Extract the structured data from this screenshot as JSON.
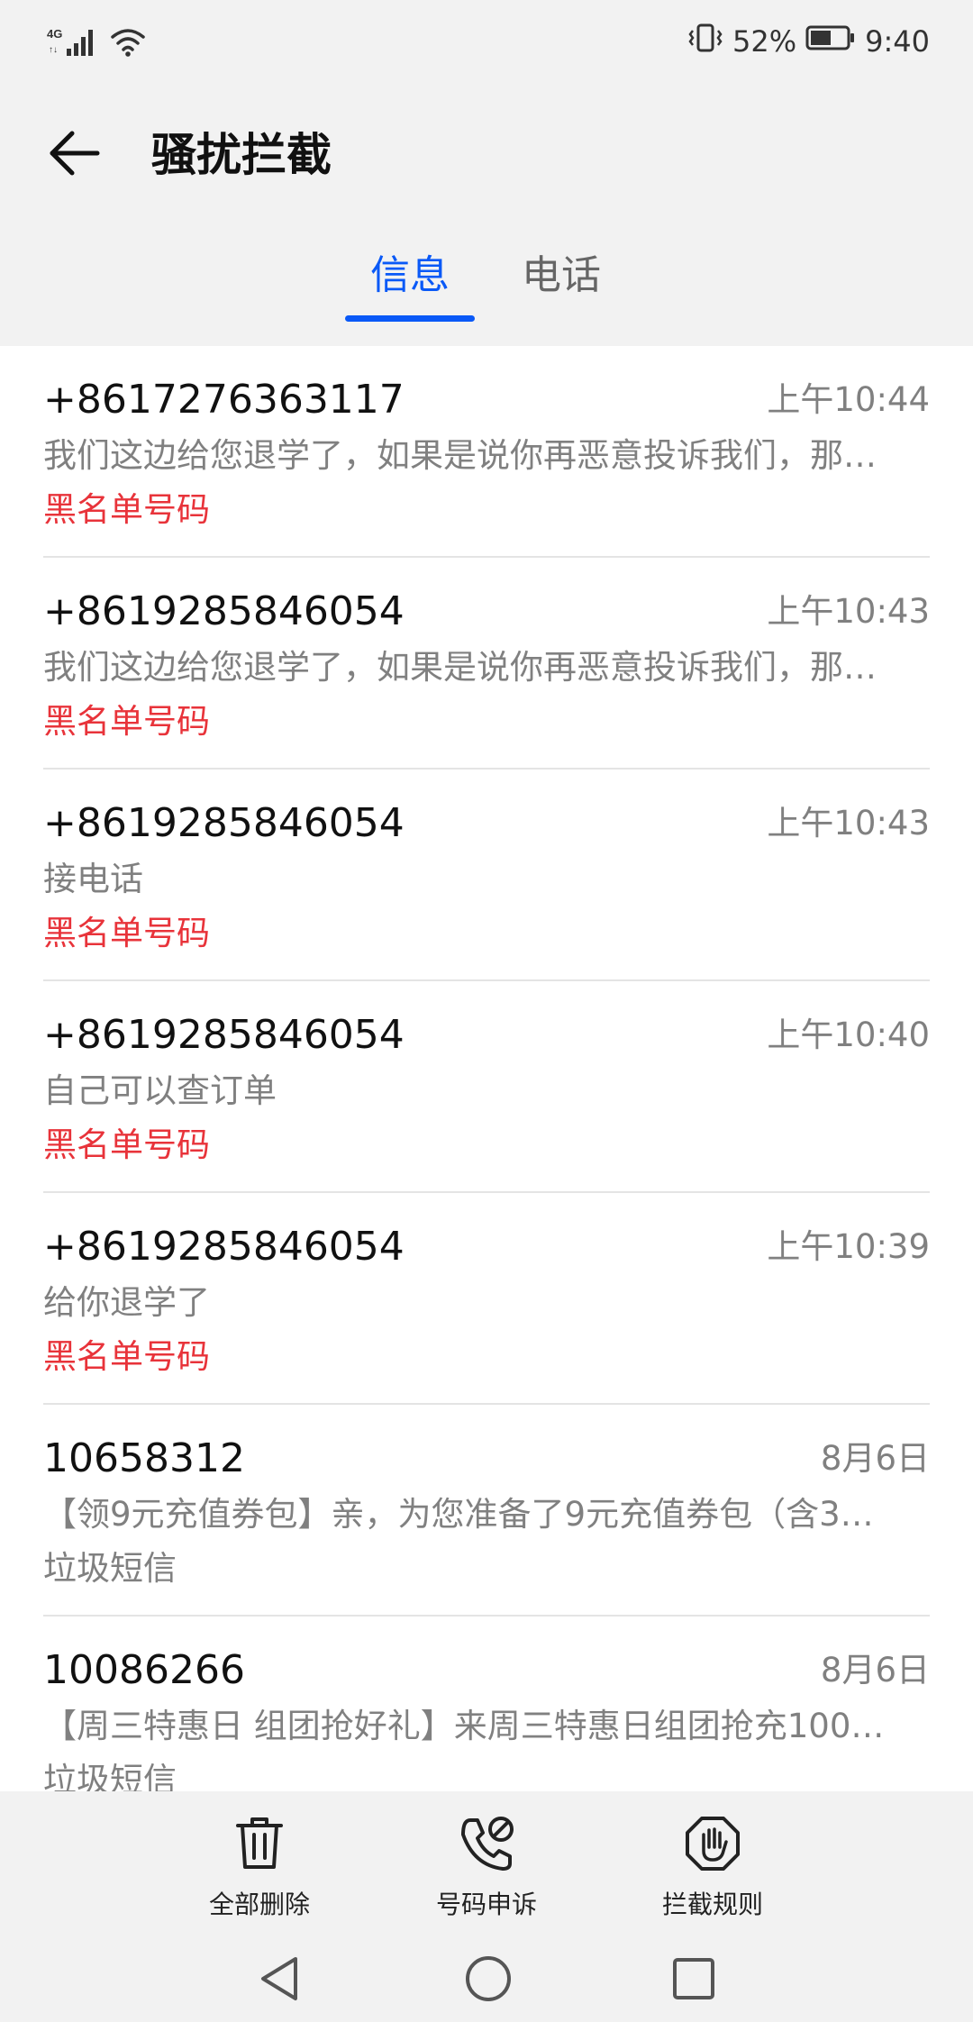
{
  "status_bar": {
    "network": "4G",
    "battery_percent": "52%",
    "time": "9:40"
  },
  "header": {
    "title": "骚扰拦截"
  },
  "tabs": [
    {
      "label": "信息",
      "active": true
    },
    {
      "label": "电话",
      "active": false
    }
  ],
  "messages": [
    {
      "number": "+8617276363117",
      "time": "上午10:44",
      "preview": "我们这边给您退学了，如果是说你再恶意投诉我们，那…",
      "tag": "黑名单号码",
      "tag_type": "blacklist"
    },
    {
      "number": "+8619285846054",
      "time": "上午10:43",
      "preview": "我们这边给您退学了，如果是说你再恶意投诉我们，那…",
      "tag": "黑名单号码",
      "tag_type": "blacklist"
    },
    {
      "number": "+8619285846054",
      "time": "上午10:43",
      "preview": "接电话",
      "tag": "黑名单号码",
      "tag_type": "blacklist"
    },
    {
      "number": "+8619285846054",
      "time": "上午10:40",
      "preview": "自己可以查订单",
      "tag": "黑名单号码",
      "tag_type": "blacklist"
    },
    {
      "number": "+8619285846054",
      "time": "上午10:39",
      "preview": "给你退学了",
      "tag": "黑名单号码",
      "tag_type": "blacklist"
    },
    {
      "number": "10658312",
      "time": "8月6日",
      "preview": "【领9元充值券包】亲，为您准备了9元充值券包（含3…",
      "tag": "垃圾短信",
      "tag_type": "spam"
    },
    {
      "number": "10086266",
      "time": "8月6日",
      "preview": "【周三特惠日 组团抢好礼】来周三特惠日组团抢充100…",
      "tag": "垃圾短信",
      "tag_type": "spam"
    }
  ],
  "toolbar": {
    "delete_all": "全部删除",
    "number_appeal": "号码申诉",
    "block_rules": "拦截规则"
  },
  "colors": {
    "accent": "#0a59f7",
    "blacklist_tag": "#e8333a",
    "secondary_text": "#808080",
    "chrome_bg": "#f2f2f2"
  },
  "icons": {
    "back": "arrow-left-icon",
    "delete": "trash-icon",
    "appeal": "phone-block-icon",
    "rules": "hand-stop-icon"
  }
}
